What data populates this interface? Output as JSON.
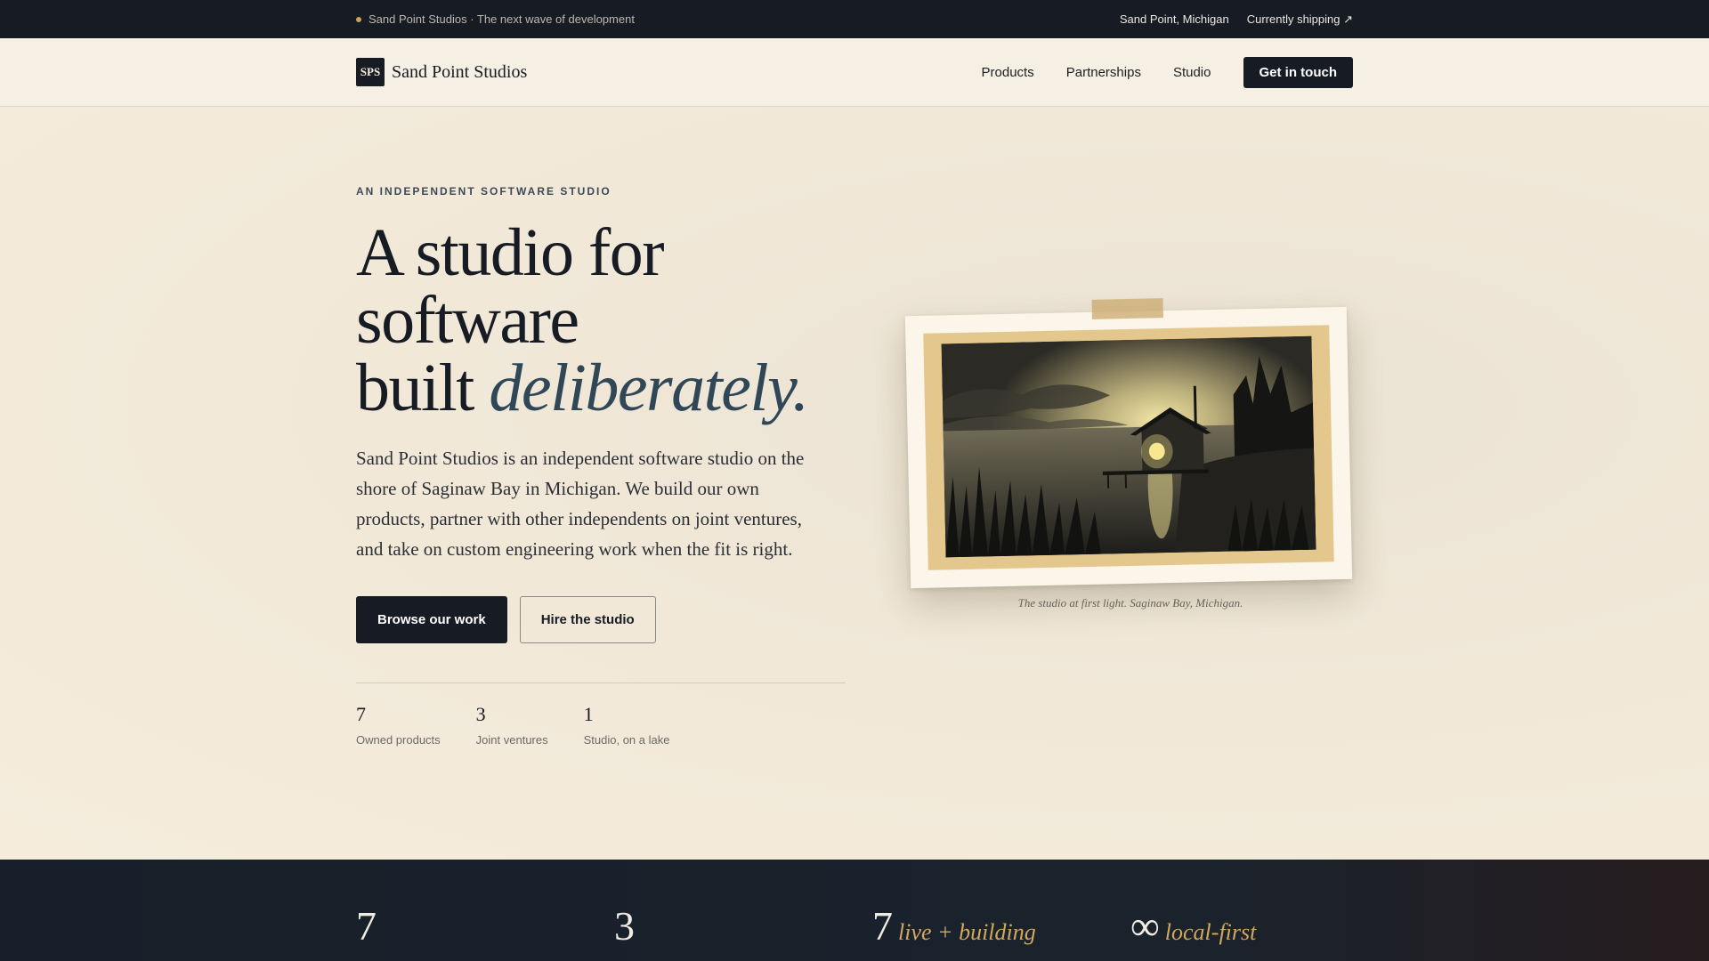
{
  "topbar": {
    "tagline": "Sand Point Studios · The next wave of development",
    "location": "Sand Point, Michigan",
    "shipping_link": "Currently shipping ↗"
  },
  "nav": {
    "logo_mark": "SPS",
    "brand": "Sand Point Studios",
    "links": [
      "Products",
      "Partnerships",
      "Studio"
    ],
    "cta": "Get in touch"
  },
  "hero": {
    "eyebrow": "AN INDEPENDENT SOFTWARE STUDIO",
    "headline_line1": "A studio for",
    "headline_line2": "software",
    "headline_line3_plain": "built ",
    "headline_line3_em": "deliberately.",
    "lede": "Sand Point Studios is an independent software studio on the shore of Saginaw Bay in Michigan. We build our own products, partner with other independents on joint ventures, and take on custom engineering work when the fit is right.",
    "primary_cta": "Browse our work",
    "secondary_cta": "Hire the studio",
    "stats": [
      {
        "value": "7",
        "label": "Owned products"
      },
      {
        "value": "3",
        "label": "Joint ventures"
      },
      {
        "value": "1",
        "label": "Studio, on a lake"
      }
    ],
    "photo_caption": "The studio at first light. Saginaw Bay, Michigan."
  },
  "band": {
    "items": [
      {
        "value": "7",
        "text": ""
      },
      {
        "value": "3",
        "text": ""
      },
      {
        "value": "7",
        "text": "live + building"
      },
      {
        "value": "∞",
        "text": "local-first"
      }
    ]
  },
  "colors": {
    "ink": "#161b24",
    "paper": "#f5eddd",
    "accent_gold": "#d2a85e",
    "accent_slate": "#2f4756"
  }
}
